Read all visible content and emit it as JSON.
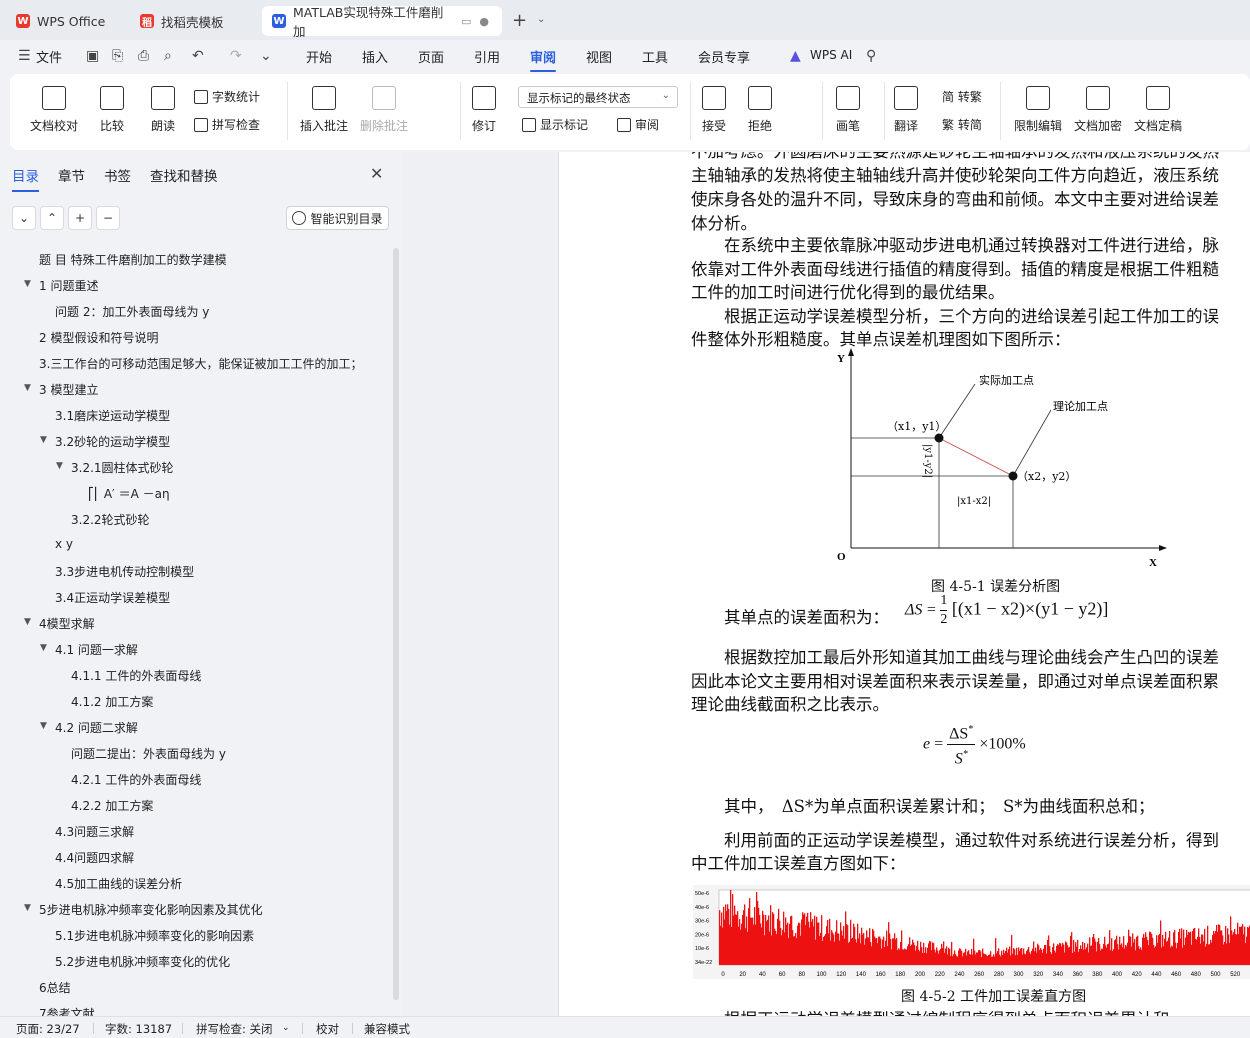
{
  "tabs": [
    {
      "label": "WPS Office",
      "color": "#e8392c",
      "glyph": "W"
    },
    {
      "label": "找稻壳模板",
      "color": "#e8392c",
      "glyph": "稻"
    },
    {
      "label": "MATLAB实现特殊工件磨削加",
      "color": "#2b5fe0",
      "glyph": "W"
    }
  ],
  "menu": {
    "file": "文件",
    "items": [
      "开始",
      "插入",
      "页面",
      "引用",
      "审阅",
      "视图",
      "工具",
      "会员专享"
    ],
    "active": "审阅",
    "ai": "WPS AI"
  },
  "ribbon": {
    "doc_check": "文档校对",
    "compare": "比较",
    "read_aloud": "朗读",
    "word_count": "字数统计",
    "spell_check": "拼写检查",
    "insert_comment": "插入批注",
    "delete_comment": "删除批注",
    "track": "修订",
    "markup_select": "显示标记的最终状态",
    "show_markup": "显示标记",
    "review": "审阅",
    "accept": "接受",
    "reject": "拒绝",
    "pen": "画笔",
    "translate": "翻译",
    "to_traditional": "简 转繁",
    "to_simplified": "繁 转简",
    "restrict": "限制编辑",
    "encrypt": "文档加密",
    "finalize": "文档定稿"
  },
  "panel": {
    "tabs": [
      "目录",
      "章节",
      "书签",
      "查找和替换"
    ],
    "smart_button": "智能识别目录",
    "outline": [
      {
        "text": "题 目 特殊工件磨削加工的数学建模",
        "level": 0,
        "arrow": false
      },
      {
        "text": "1 问题重述",
        "level": 0,
        "arrow": true
      },
      {
        "text": "问题 2：加工外表面母线为 y",
        "level": 1,
        "arrow": false
      },
      {
        "text": "2 模型假设和符号说明",
        "level": 0,
        "arrow": false
      },
      {
        "text": "3.三工作台的可移动范围足够大，能保证被加工工件的加工；",
        "level": 0,
        "arrow": false
      },
      {
        "text": "3 模型建立",
        "level": 0,
        "arrow": true
      },
      {
        "text": "3.1磨床逆运动学模型",
        "level": 1,
        "arrow": false
      },
      {
        "text": "3.2砂轮的运动学模型",
        "level": 1,
        "arrow": true
      },
      {
        "text": "3.2.1圆柱体式砂轮",
        "level": 2,
        "arrow": true
      },
      {
        "text": "⎡⎢ A′ ＝A －aη",
        "level": 3,
        "arrow": false
      },
      {
        "text": "3.2.2轮式砂轮",
        "level": 2,
        "arrow": false
      },
      {
        "text": "x y",
        "level": 1,
        "arrow": false
      },
      {
        "text": "3.3步进电机传动控制模型",
        "level": 1,
        "arrow": false
      },
      {
        "text": "3.4正运动学误差模型",
        "level": 1,
        "arrow": false
      },
      {
        "text": "4模型求解",
        "level": 0,
        "arrow": true
      },
      {
        "text": "4.1 问题一求解",
        "level": 1,
        "arrow": true
      },
      {
        "text": "4.1.1 工件的外表面母线",
        "level": 2,
        "arrow": false
      },
      {
        "text": "4.1.2 加工方案",
        "level": 2,
        "arrow": false
      },
      {
        "text": "4.2 问题二求解",
        "level": 1,
        "arrow": true
      },
      {
        "text": "问题二提出：外表面母线为 y",
        "level": 2,
        "arrow": false
      },
      {
        "text": "4.2.1 工件的外表面母线",
        "level": 2,
        "arrow": false
      },
      {
        "text": "4.2.2 加工方案",
        "level": 2,
        "arrow": false
      },
      {
        "text": "4.3问题三求解",
        "level": 1,
        "arrow": false
      },
      {
        "text": "4.4问题四求解",
        "level": 1,
        "arrow": false
      },
      {
        "text": "4.5加工曲线的误差分析",
        "level": 1,
        "arrow": false
      },
      {
        "text": "5步进电机脉冲频率变化影响因素及其优化",
        "level": 0,
        "arrow": true
      },
      {
        "text": "5.1步进电机脉冲频率变化的影响因素",
        "level": 1,
        "arrow": false
      },
      {
        "text": "5.2步进电机脉冲频率变化的优化",
        "level": 1,
        "arrow": false
      },
      {
        "text": "6总结",
        "level": 0,
        "arrow": false
      },
      {
        "text": "7参考文献",
        "level": 0,
        "arrow": false
      }
    ]
  },
  "doc": {
    "paragraphs": [
      "不加考虑。外圆磨床的主要热源是砂轮主轴轴承的发热和液压系统的发热",
      "主轴轴承的发热将使主轴轴线升高并使砂轮架向工件方向趋近，液压系统",
      "使床身各处的温升不同，导致床身的弯曲和前倾。本文中主要对进给误差",
      "体分析。",
      "　　在系统中主要依靠脉冲驱动步进电机通过转换器对工件进行进给，脉",
      "依靠对工件外表面母线进行插值的精度得到。插值的精度是根据工件粗糙",
      "工件的加工时间进行优化得到的最优结果。",
      "　　根据正运动学误差模型分析，三个方向的进给误差引起工件加工的误",
      "件整体外形粗糙度。其单点误差机理图如下图所示："
    ],
    "fig1": {
      "y_label": "Y",
      "x_label": "X",
      "origin": "O",
      "actual_point": "实际加工点",
      "theory_point": "理论加工点",
      "p1": "（x1，y1）",
      "p2": "（x2，y2）",
      "dy": "|y1-y2|",
      "dx": "|x1-x2|",
      "caption": "图 4-5-1 误差分析图"
    },
    "area_intro": "　　其单点的误差面积为：",
    "area_formula": "ΔS = ½ [(x1 − x2)×(y1 − y2)]",
    "para2": [
      "　　根据数控加工最后外形知道其加工曲线与理论曲线会产生凸凹的误差",
      "因此本论文主要用相对误差面积来表示误差量，即通过对单点误差面积累",
      "理论曲线截面积之比表示。"
    ],
    "ratio_formula": "e = ΔS* / S* ×100%",
    "where_text": "　　其中，　ΔS*为单点面积误差累计和；　S*为曲线面积总和；",
    "para3": [
      "　　利用前面的正运动学误差模型，通过软件对系统进行误差分析，得到",
      "中工件加工误差直方图如下："
    ],
    "fig2": {
      "y_ticks": [
        "50e-6",
        "40e-6",
        "30e-6",
        "20e-6",
        "10e-6",
        "34e-22"
      ],
      "x_ticks": [
        "0",
        "20",
        "40",
        "60",
        "80",
        "100",
        "120",
        "140",
        "160",
        "180",
        "200",
        "220",
        "240",
        "260",
        "280",
        "300",
        "320",
        "340",
        "360",
        "380",
        "400",
        "420",
        "440",
        "460",
        "480",
        "500",
        "520"
      ],
      "caption": "图 4-5-2 工件加工误差直方图",
      "bar_color": "#ee1111"
    },
    "tail": "　　根据正运动学误差模型通过编制程序得到单点面积误差累计和"
  },
  "status": {
    "page": "页面: 23/27",
    "words": "字数: 13187",
    "spell": "拼写检查: 关闭",
    "proof": "校对",
    "compat": "兼容模式"
  }
}
